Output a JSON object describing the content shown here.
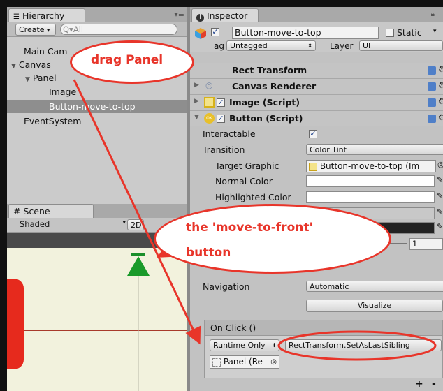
{
  "hierarchy": {
    "tab_label": "Hierarchy",
    "create_label": "Create",
    "search_placeholder": "Q▾All",
    "items": [
      "Main Cam",
      "Canvas",
      "Panel",
      "Image",
      "Button-move-to-top",
      "EventSystem"
    ]
  },
  "scene": {
    "tab_label": "Scene",
    "shading": "Shaded",
    "mode_2d": "2D"
  },
  "inspector": {
    "tab_label": "Inspector",
    "object_name": "Button-move-to-top",
    "static_label": "Static",
    "tag_label": "ag",
    "tag_value": "Untagged",
    "layer_label": "Layer",
    "layer_value": "UI",
    "components": {
      "rect_transform": "Rect Transform",
      "canvas_renderer": "Canvas Renderer",
      "image_script": "Image (Script)",
      "button_script": "Button (Script)"
    },
    "fields": {
      "interactable": "Interactable",
      "transition": "Transition",
      "transition_value": "Color Tint",
      "target_graphic": "Target Graphic",
      "target_graphic_value": "Button-move-to-top (Im",
      "normal_color": "Normal Color",
      "highlighted_color": "Highlighted Color",
      "multiplier_value": "1",
      "navigation": "Navigation",
      "navigation_value": "Automatic",
      "visualize": "Visualize",
      "on_click": "On Click ()",
      "runtime": "Runtime Only",
      "function": "RectTransform.SetAsLastSibling",
      "target_object": "Panel (Re"
    },
    "plus": "+",
    "minus": "-"
  },
  "annotations": {
    "drag_panel": "drag Panel",
    "move_front_line1": "the 'move-to-front'",
    "move_front_line2": "button"
  },
  "colors": {
    "annotation_red": "#e8352a",
    "selection_gray": "#8e8e8e"
  }
}
